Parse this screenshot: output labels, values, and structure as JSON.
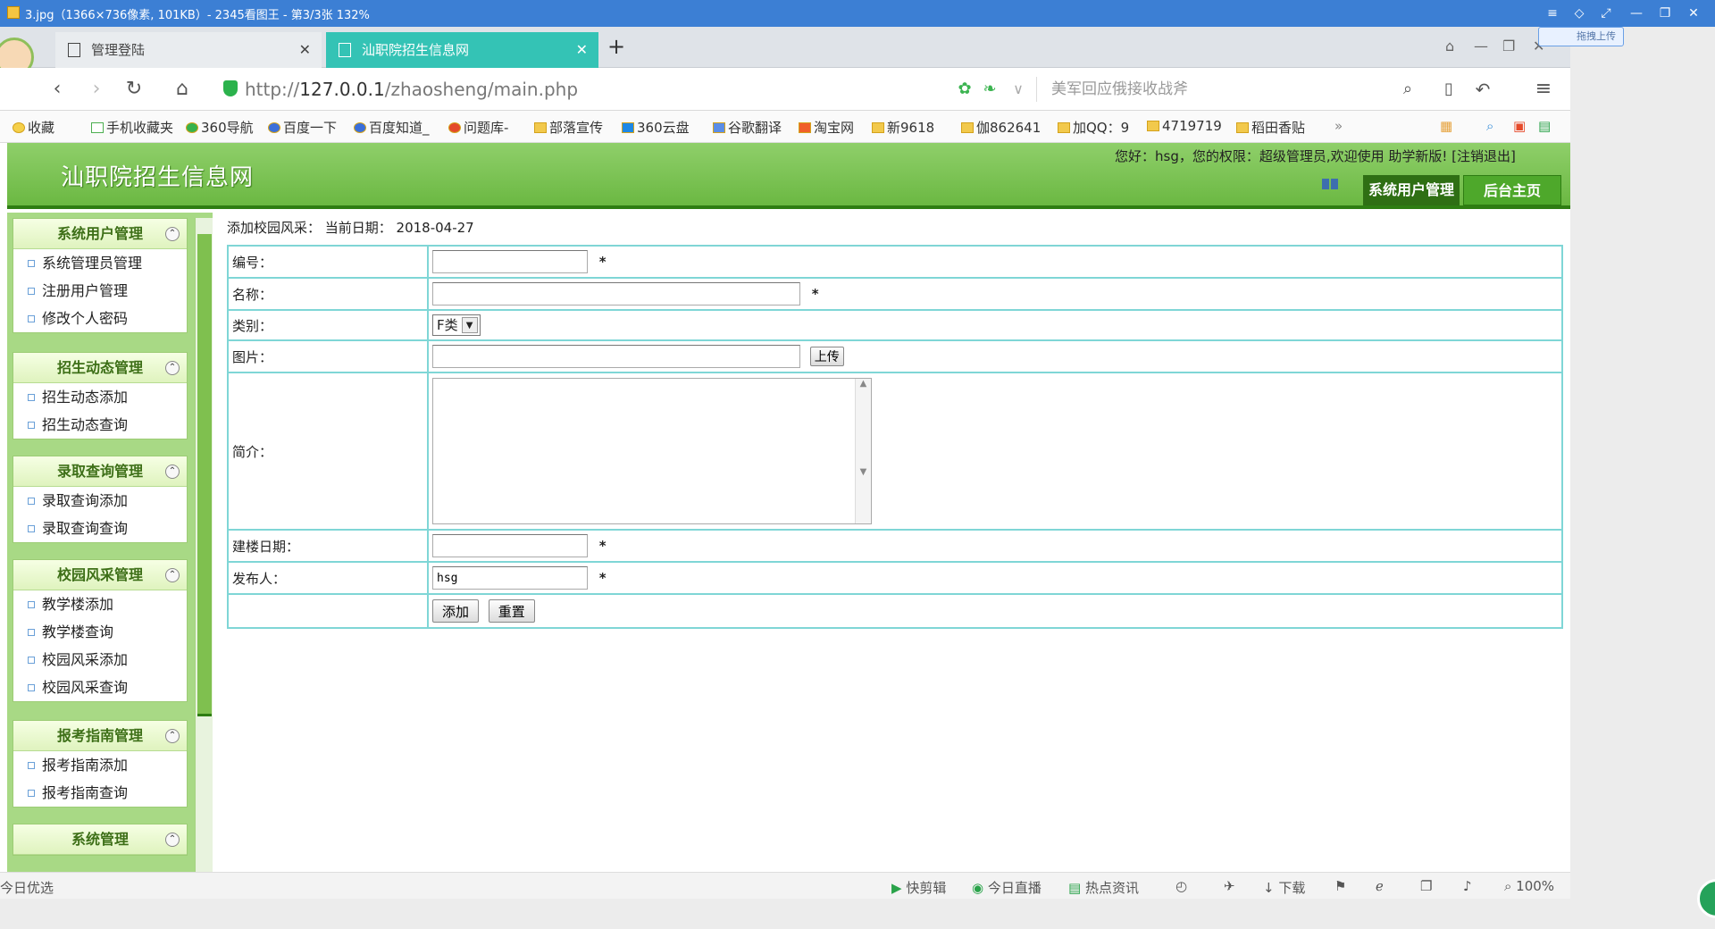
{
  "viewer": {
    "title": "3.jpg（1366×736像素, 101KB）- 2345看图王 - 第3/3张 132%"
  },
  "browser": {
    "tabs": [
      {
        "label": "管理登陆"
      },
      {
        "label": "汕职院招生信息网"
      }
    ],
    "url_prefix": "http://",
    "url_host": "127.0.0.1",
    "url_path": "/zhaosheng/main.php",
    "search_placeholder": "美军回应俄接收战斧",
    "upload_pill": "拖拽上传",
    "bookmarks": [
      "收藏",
      "手机收藏夹",
      "360导航",
      "百度一下",
      "百度知道_",
      "问题库-",
      "部落宣传",
      "360云盘",
      "谷歌翻译",
      "淘宝网",
      "新9618",
      "伽862641",
      "加QQ：9",
      "4719719",
      "稻田香贴",
      "»"
    ]
  },
  "site": {
    "title": "汕职院招生信息网",
    "welcome": "您好：hsg，您的权限：超级管理员,欢迎使用  助学新版!  [注销退出]",
    "nav_tabs": [
      "系统用户管理",
      "后台主页"
    ]
  },
  "sidebar": {
    "groups": [
      {
        "title": "系统用户管理",
        "items": [
          "系统管理员管理",
          "注册用户管理",
          "修改个人密码"
        ]
      },
      {
        "title": "招生动态管理",
        "items": [
          "招生动态添加",
          "招生动态查询"
        ]
      },
      {
        "title": "录取查询管理",
        "items": [
          "录取查询添加",
          "录取查询查询"
        ]
      },
      {
        "title": "校园风采管理",
        "items": [
          "教学楼添加",
          "教学楼查询",
          "校园风采添加",
          "校园风采查询"
        ]
      },
      {
        "title": "报考指南管理",
        "items": [
          "报考指南添加",
          "报考指南查询"
        ]
      },
      {
        "title": "系统管理",
        "items": []
      }
    ]
  },
  "form": {
    "caption": "添加校园风采：  当前日期：  2018-04-27",
    "fields": {
      "number_label": "编号：",
      "name_label": "名称：",
      "category_label": "类别：",
      "category_value": "F类",
      "image_label": "图片：",
      "upload_button": "上传",
      "intro_label": "简介：",
      "build_date_label": "建楼日期：",
      "publisher_label": "发布人：",
      "publisher_value": "hsg",
      "required_mark": "*"
    },
    "buttons": {
      "add": "添加",
      "reset": "重置"
    }
  },
  "statusbar": {
    "left": "今日优选",
    "items": [
      "快剪辑",
      "今日直播",
      "热点资讯",
      "下载"
    ],
    "zoom": "100%"
  }
}
